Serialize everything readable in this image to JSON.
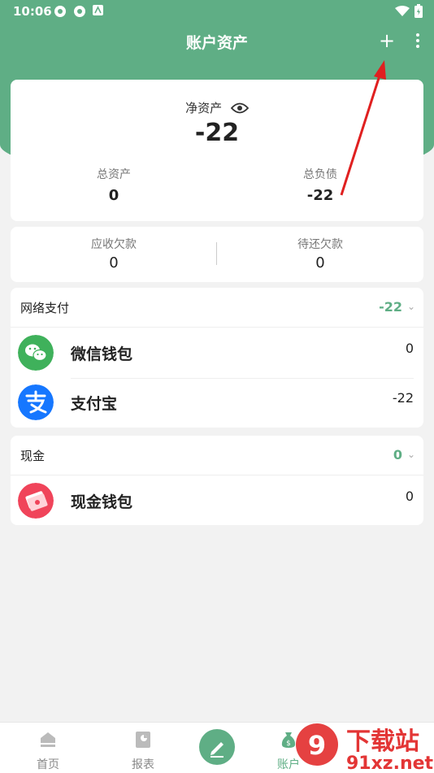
{
  "status_bar": {
    "time": "10:06"
  },
  "header": {
    "title": "账户资产",
    "add_symbol": "+"
  },
  "net_assets": {
    "label": "净资产",
    "value": "-22",
    "total_assets_label": "总资产",
    "total_assets_value": "0",
    "total_liabilities_label": "总负债",
    "total_liabilities_value": "-22"
  },
  "debts": {
    "receivable_label": "应收欠款",
    "receivable_value": "0",
    "payable_label": "待还欠款",
    "payable_value": "0"
  },
  "groups": [
    {
      "title": "网络支付",
      "amount": "-22",
      "accounts": [
        {
          "name": "微信钱包",
          "amount": "0",
          "icon": "wechat-icon"
        },
        {
          "name": "支付宝",
          "amount": "-22",
          "icon": "alipay-icon"
        }
      ]
    },
    {
      "title": "现金",
      "amount": "0",
      "accounts": [
        {
          "name": "现金钱包",
          "amount": "0",
          "icon": "cash-icon"
        }
      ]
    }
  ],
  "tabbar": {
    "home": "首页",
    "report": "报表",
    "account": "账户"
  },
  "watermark": {
    "line1": "下载站",
    "line2": "91xz.net"
  },
  "colors": {
    "accent": "#5fae85",
    "wechat": "#3fb15b",
    "alipay": "#1677ff",
    "cash": "#f0445a",
    "arrow": "#e02020"
  }
}
